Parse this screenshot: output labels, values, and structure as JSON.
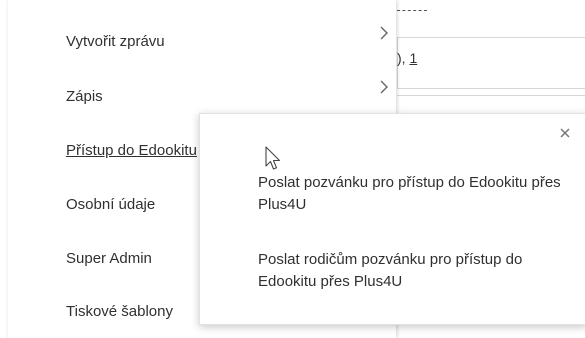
{
  "background": {
    "field_text_prefix": "), ",
    "field_text_link": "1"
  },
  "menu": {
    "items": [
      {
        "label": "Vytvořit zprávu",
        "has_submenu": true
      },
      {
        "label": "Zápis",
        "has_submenu": true
      },
      {
        "label": "Přístup do Edookitu",
        "has_submenu": true,
        "active": true
      },
      {
        "label": "Osobní údaje",
        "has_submenu": false
      },
      {
        "label": "Super Admin",
        "has_submenu": false
      },
      {
        "label": "Tiskové šablony",
        "has_submenu": false
      }
    ]
  },
  "popup": {
    "close_icon": "close-icon",
    "links": [
      {
        "label": "Poslat pozvánku pro přístup do Edookitu přes Plus4U"
      },
      {
        "label": "Poslat rodičům pozvánku pro přístup do Edookitu přes Plus4U"
      }
    ]
  },
  "colors": {
    "text": "#303030",
    "popup_border": "#e2e2e2",
    "chevron": "#666666"
  }
}
